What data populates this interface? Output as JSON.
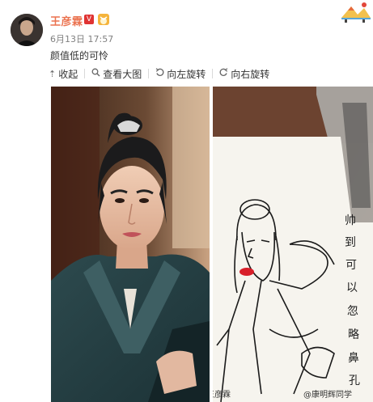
{
  "post": {
    "username": "王彦霖",
    "verified_badge": "V",
    "timestamp": "6月13日 17:57",
    "text": "颜值低的可怜"
  },
  "toolbar": {
    "collapse": "收起",
    "view_large": "查看大图",
    "rotate_left": "向左旋转",
    "rotate_right": "向右旋转"
  },
  "images": {
    "left_watermark": "@王彦霖",
    "right_watermark": "@康明辉同学",
    "drawing_caption": [
      "帅",
      "到",
      "可",
      "以",
      "忽",
      "略",
      "鼻",
      "孔"
    ]
  },
  "icons": {
    "collapse": "arrow-up-icon",
    "view_large": "zoom-icon",
    "rotate_left": "rotate-left-icon",
    "rotate_right": "rotate-right-icon"
  },
  "colors": {
    "username": "#eb7350",
    "verified": "#e03333",
    "lips": "#d81f2a"
  }
}
